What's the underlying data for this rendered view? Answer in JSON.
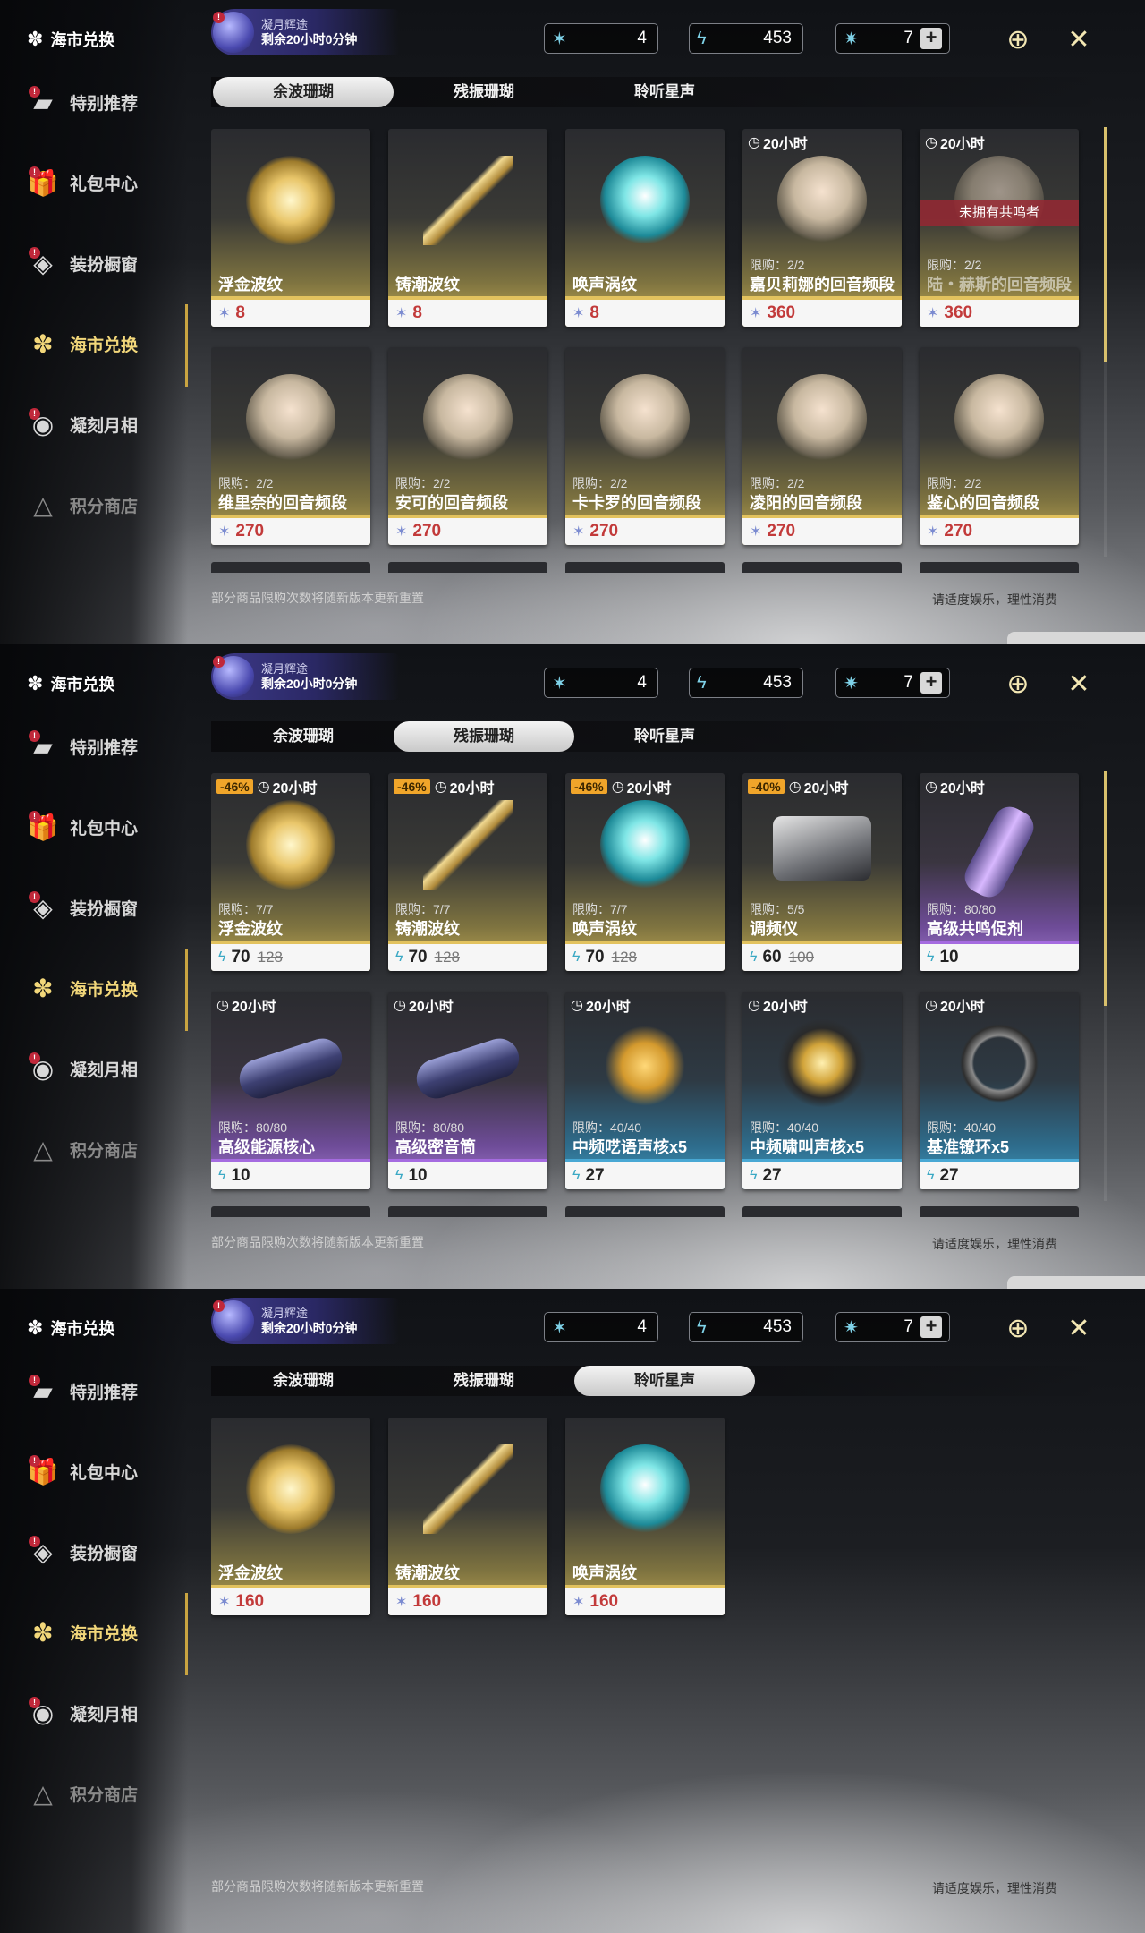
{
  "top": {
    "title": "海市兑换",
    "event_line1": "凝月辉途",
    "event_line2": "剩余20小时0分钟",
    "currencies": [
      {
        "icon": "coral-icon",
        "value": "4"
      },
      {
        "icon": "feather-icon",
        "value": "453"
      },
      {
        "icon": "star-crystal-icon",
        "value": "7"
      }
    ],
    "plus": "+",
    "badge": "!"
  },
  "sidebar": [
    "特别推荐",
    "礼包中心",
    "装扮橱窗",
    "海市兑换",
    "凝刻月相",
    "积分商店"
  ],
  "tabs": [
    "余波珊瑚",
    "残振珊瑚",
    "聆听星声"
  ],
  "footer": {
    "left": "部分商品限购次数将随新版本更新重置",
    "right": "请适度娱乐，理性消费"
  },
  "panels": [
    {
      "active_tab": 1,
      "cards": [
        {
          "name": "浮金波纹",
          "price": "8",
          "art": "gold",
          "color": "gold"
        },
        {
          "name": "铸潮波纹",
          "price": "8",
          "art": "blade",
          "color": "gold"
        },
        {
          "name": "唤声涡纹",
          "price": "8",
          "art": "teal",
          "color": "gold"
        },
        {
          "name": "嘉贝莉娜的回音频段",
          "price": "360",
          "timer": "20小时",
          "limit": "限购：2/2",
          "art": "portrait",
          "color": "gold"
        },
        {
          "name": "陆・赫斯的回音频段",
          "price": "360",
          "timer": "20小时",
          "limit": "限购：2/2",
          "banner": "未拥有共鸣者",
          "locked": true,
          "art": "portrait",
          "color": "gold"
        },
        {
          "name": "维里奈的回音频段",
          "price": "270",
          "limit": "限购：2/2",
          "art": "portrait",
          "color": "gold"
        },
        {
          "name": "安可的回音频段",
          "price": "270",
          "limit": "限购：2/2",
          "art": "portrait",
          "color": "gold"
        },
        {
          "name": "卡卡罗的回音频段",
          "price": "270",
          "limit": "限购：2/2",
          "art": "portrait",
          "color": "gold"
        },
        {
          "name": "凌阳的回音频段",
          "price": "270",
          "limit": "限购：2/2",
          "art": "portrait",
          "color": "gold"
        },
        {
          "name": "鉴心的回音频段",
          "price": "270",
          "limit": "限购：2/2",
          "art": "portrait",
          "color": "gold"
        }
      ]
    },
    {
      "active_tab": 2,
      "cards": [
        {
          "name": "浮金波纹",
          "price": "70",
          "old": "128",
          "disc": "-46%",
          "timer": "20小时",
          "limit": "限购：7/7",
          "art": "gold",
          "color": "gold",
          "dark": true
        },
        {
          "name": "铸潮波纹",
          "price": "70",
          "old": "128",
          "disc": "-46%",
          "timer": "20小时",
          "limit": "限购：7/7",
          "art": "blade",
          "color": "gold",
          "dark": true
        },
        {
          "name": "唤声涡纹",
          "price": "70",
          "old": "128",
          "disc": "-46%",
          "timer": "20小时",
          "limit": "限购：7/7",
          "art": "teal",
          "color": "gold",
          "dark": true
        },
        {
          "name": "调频仪",
          "price": "60",
          "old": "100",
          "disc": "-40%",
          "timer": "20小时",
          "limit": "限购：5/5",
          "art": "device",
          "color": "gold",
          "dark": true
        },
        {
          "name": "高级共鸣促剂",
          "price": "10",
          "timer": "20小时",
          "limit": "限购：80/80",
          "art": "vial",
          "color": "purple",
          "dark": true
        },
        {
          "name": "高级能源核心",
          "price": "10",
          "timer": "20小时",
          "limit": "限购：80/80",
          "art": "capsule",
          "color": "purple",
          "dark": true
        },
        {
          "name": "高级密音筒",
          "price": "10",
          "timer": "20小时",
          "limit": "限购：80/80",
          "art": "capsule",
          "color": "purple",
          "dark": true
        },
        {
          "name": "中频呓语声核x5",
          "price": "27",
          "timer": "20小时",
          "limit": "限购：40/40",
          "art": "star",
          "color": "blue",
          "dark": true
        },
        {
          "name": "中频啸叫声核x5",
          "price": "27",
          "timer": "20小时",
          "limit": "限购：40/40",
          "art": "orb",
          "color": "blue",
          "dark": true
        },
        {
          "name": "基准镣环x5",
          "price": "27",
          "timer": "20小时",
          "limit": "限购：40/40",
          "art": "ring",
          "color": "blue",
          "dark": true
        }
      ]
    },
    {
      "active_tab": 3,
      "cards": [
        {
          "name": "浮金波纹",
          "price": "160",
          "art": "gold",
          "color": "gold"
        },
        {
          "name": "铸潮波纹",
          "price": "160",
          "art": "blade",
          "color": "gold"
        },
        {
          "name": "唤声涡纹",
          "price": "160",
          "art": "teal",
          "color": "gold"
        }
      ]
    }
  ]
}
